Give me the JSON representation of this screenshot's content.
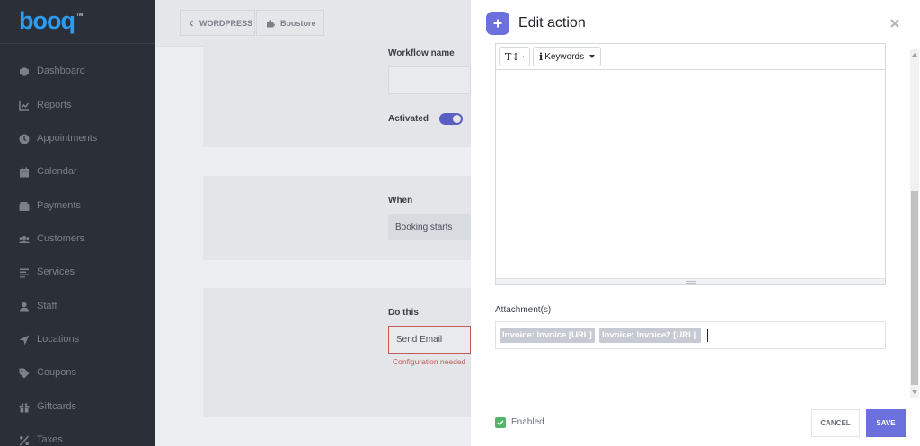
{
  "brand": {
    "logo_text": "booq",
    "trademark": "TM",
    "accent": "#6c70dc"
  },
  "sidebar": {
    "items": [
      {
        "label": "Dashboard",
        "icon": "cube-icon"
      },
      {
        "label": "Reports",
        "icon": "chart-line-icon"
      },
      {
        "label": "Appointments",
        "icon": "clock-icon"
      },
      {
        "label": "Calendar",
        "icon": "calendar-icon"
      },
      {
        "label": "Payments",
        "icon": "wallet-icon"
      },
      {
        "label": "Customers",
        "icon": "users-icon"
      },
      {
        "label": "Services",
        "icon": "list-icon"
      },
      {
        "label": "Staff",
        "icon": "user-icon"
      },
      {
        "label": "Locations",
        "icon": "location-arrow-icon"
      },
      {
        "label": "Coupons",
        "icon": "tag-icon"
      },
      {
        "label": "Giftcards",
        "icon": "gift-icon"
      },
      {
        "label": "Taxes",
        "icon": "percent-icon"
      }
    ]
  },
  "topbar": {
    "back_label": "WORDPRESS",
    "store_label": "Boostore"
  },
  "workflow": {
    "name_label": "Workflow name",
    "activated_label": "Activated",
    "when_label": "When",
    "when_value": "Booking starts",
    "do_label": "Do this",
    "do_value": "Send Email",
    "do_error": "Configuration needed"
  },
  "panel": {
    "title": "Edit action",
    "toolbar": {
      "text_tool": "T↕",
      "keywords_label": "Keywords"
    },
    "attachments_label": "Attachment(s)",
    "attachments": [
      "Invoice: Invoice [URL]",
      "Invoice: Invoice2 [URL]"
    ],
    "enabled_label": "Enabled",
    "cancel_label": "CANCEL",
    "save_label": "SAVE"
  }
}
